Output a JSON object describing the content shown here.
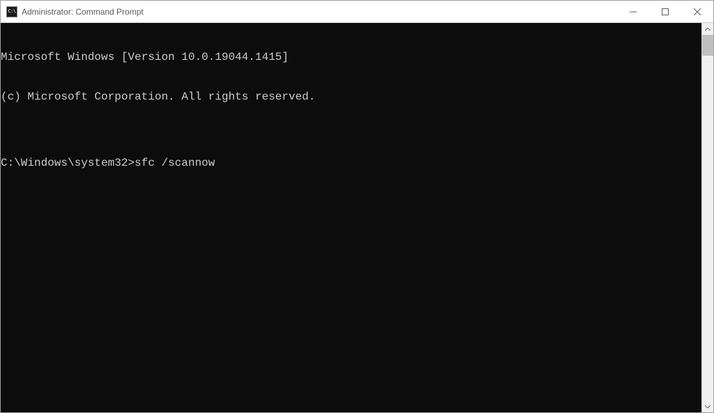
{
  "window": {
    "title": "Administrator: Command Prompt",
    "icon_label": "C:\\"
  },
  "terminal": {
    "lines": [
      "Microsoft Windows [Version 10.0.19044.1415]",
      "(c) Microsoft Corporation. All rights reserved.",
      "",
      "C:\\Windows\\system32>sfc /scannow"
    ]
  }
}
